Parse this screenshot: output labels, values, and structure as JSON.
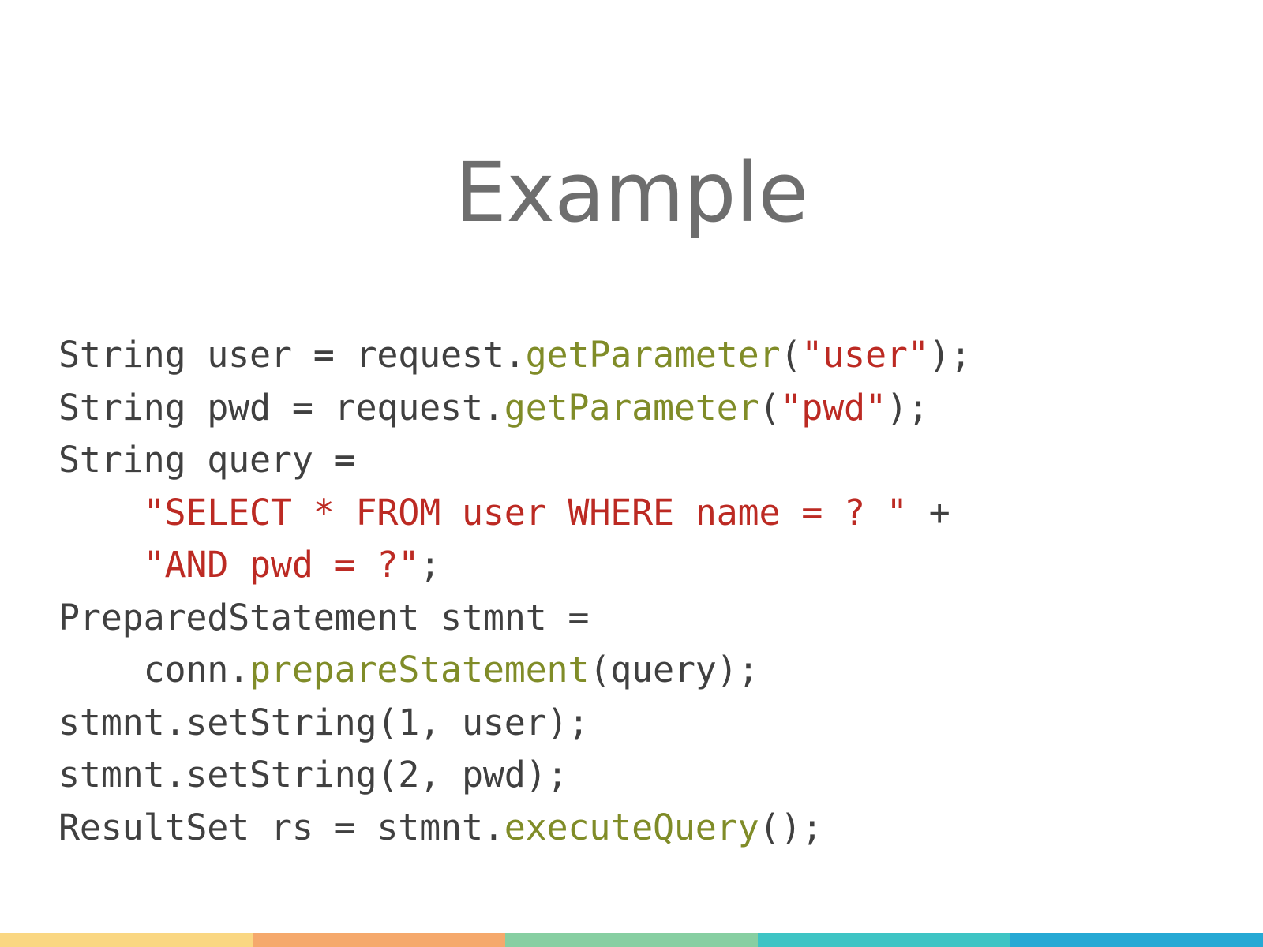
{
  "slide": {
    "title": "Example",
    "title_color": "#6e6e6e",
    "background_color": "#ffffff"
  },
  "code": {
    "language": "java",
    "text_color": "#404040",
    "method_color": "#808c28",
    "string_color": "#bc2a23",
    "raw": "String user = request.getParameter(\"user\");\nString pwd = request.getParameter(\"pwd\");\nString query =\n    \"SELECT * FROM user WHERE name = ? \" +\n    \"AND pwd = ?\";\nPreparedStatement stmnt =\n    conn.prepareStatement(query);\nstmnt.setString(1, user);\nstmnt.setString(2, pwd);\nResultSet rs = stmnt.executeQuery();",
    "lines": [
      {
        "id": "line-1",
        "tokens": [
          {
            "t": "String user = request.",
            "k": "plain"
          },
          {
            "t": "getParameter",
            "k": "method"
          },
          {
            "t": "(",
            "k": "plain"
          },
          {
            "t": "\"user\"",
            "k": "string"
          },
          {
            "t": ");",
            "k": "plain"
          }
        ]
      },
      {
        "id": "line-2",
        "tokens": [
          {
            "t": "String pwd = request.",
            "k": "plain"
          },
          {
            "t": "getParameter",
            "k": "method"
          },
          {
            "t": "(",
            "k": "plain"
          },
          {
            "t": "\"pwd\"",
            "k": "string"
          },
          {
            "t": ");",
            "k": "plain"
          }
        ]
      },
      {
        "id": "line-3",
        "tokens": [
          {
            "t": "String query =",
            "k": "plain"
          }
        ]
      },
      {
        "id": "line-4",
        "tokens": [
          {
            "t": "    ",
            "k": "plain"
          },
          {
            "t": "\"SELECT * FROM user WHERE name = ? \"",
            "k": "string"
          },
          {
            "t": " +",
            "k": "plain"
          }
        ]
      },
      {
        "id": "line-5",
        "tokens": [
          {
            "t": "    ",
            "k": "plain"
          },
          {
            "t": "\"AND pwd = ?\"",
            "k": "string"
          },
          {
            "t": ";",
            "k": "plain"
          }
        ]
      },
      {
        "id": "line-6",
        "tokens": [
          {
            "t": "PreparedStatement stmnt =",
            "k": "plain"
          }
        ]
      },
      {
        "id": "line-7",
        "tokens": [
          {
            "t": "    conn.",
            "k": "plain"
          },
          {
            "t": "prepareStatement",
            "k": "method"
          },
          {
            "t": "(query);",
            "k": "plain"
          }
        ]
      },
      {
        "id": "line-8",
        "tokens": [
          {
            "t": "stmnt.setString(1, user);",
            "k": "plain"
          }
        ]
      },
      {
        "id": "line-9",
        "tokens": [
          {
            "t": "stmnt.setString(2, pwd);",
            "k": "plain"
          }
        ]
      },
      {
        "id": "line-10",
        "tokens": [
          {
            "t": "ResultSet rs = stmnt.",
            "k": "plain"
          },
          {
            "t": "executeQuery",
            "k": "method"
          },
          {
            "t": "();",
            "k": "plain"
          }
        ]
      }
    ]
  },
  "bottom_bar": {
    "segments": [
      {
        "name": "bar-segment-yellow",
        "color": "#fad782"
      },
      {
        "name": "bar-segment-orange",
        "color": "#f5a96c"
      },
      {
        "name": "bar-segment-green",
        "color": "#87cfa2"
      },
      {
        "name": "bar-segment-teal",
        "color": "#3ec4c4"
      },
      {
        "name": "bar-segment-blue",
        "color": "#26a9d4"
      }
    ]
  }
}
